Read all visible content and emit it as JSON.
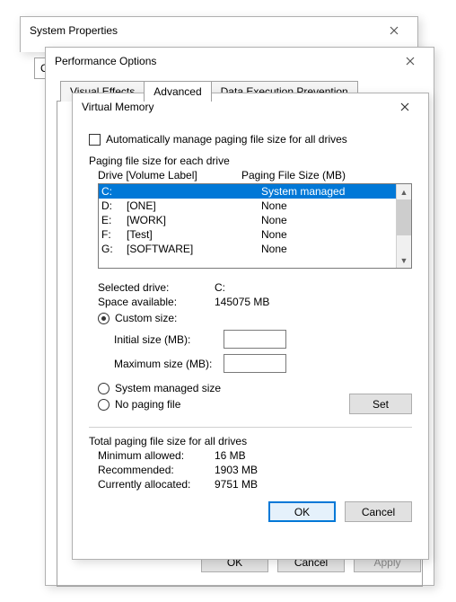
{
  "sysprops": {
    "title": "System Properties",
    "partial_tab": "Co"
  },
  "perf": {
    "title": "Performance Options",
    "tabs": [
      "Visual Effects",
      "Advanced",
      "Data Execution Prevention"
    ],
    "selected_tab_index": 1,
    "buttons": {
      "ok": "OK",
      "cancel": "Cancel",
      "apply": "Apply"
    }
  },
  "vm": {
    "title": "Virtual Memory",
    "auto_manage_label": "Automatically manage paging file size for all drives",
    "auto_manage_checked": false,
    "section_each_drive": "Paging file size for each drive",
    "header_drive": "Drive  [Volume Label]",
    "header_size": "Paging File Size (MB)",
    "drives": [
      {
        "letter": "C:",
        "label": "",
        "size": "System managed",
        "selected": true
      },
      {
        "letter": "D:",
        "label": "[ONE]",
        "size": "None",
        "selected": false
      },
      {
        "letter": "E:",
        "label": "[WORK]",
        "size": "None",
        "selected": false
      },
      {
        "letter": "F:",
        "label": "[Test]",
        "size": "None",
        "selected": false
      },
      {
        "letter": "G:",
        "label": "[SOFTWARE]",
        "size": "None",
        "selected": false
      }
    ],
    "selected_drive_label": "Selected drive:",
    "selected_drive_value": "C:",
    "space_available_label": "Space available:",
    "space_available_value": "145075 MB",
    "custom_size_label": "Custom size:",
    "initial_size_label": "Initial size (MB):",
    "initial_size_value": "",
    "maximum_size_label": "Maximum size (MB):",
    "maximum_size_value": "",
    "system_managed_label": "System managed size",
    "no_paging_label": "No paging file",
    "selected_radio": "custom",
    "set_button": "Set",
    "totals_header": "Total paging file size for all drives",
    "min_allowed_label": "Minimum allowed:",
    "min_allowed_value": "16 MB",
    "recommended_label": "Recommended:",
    "recommended_value": "1903 MB",
    "current_label": "Currently allocated:",
    "current_value": "9751 MB",
    "buttons": {
      "ok": "OK",
      "cancel": "Cancel"
    }
  }
}
